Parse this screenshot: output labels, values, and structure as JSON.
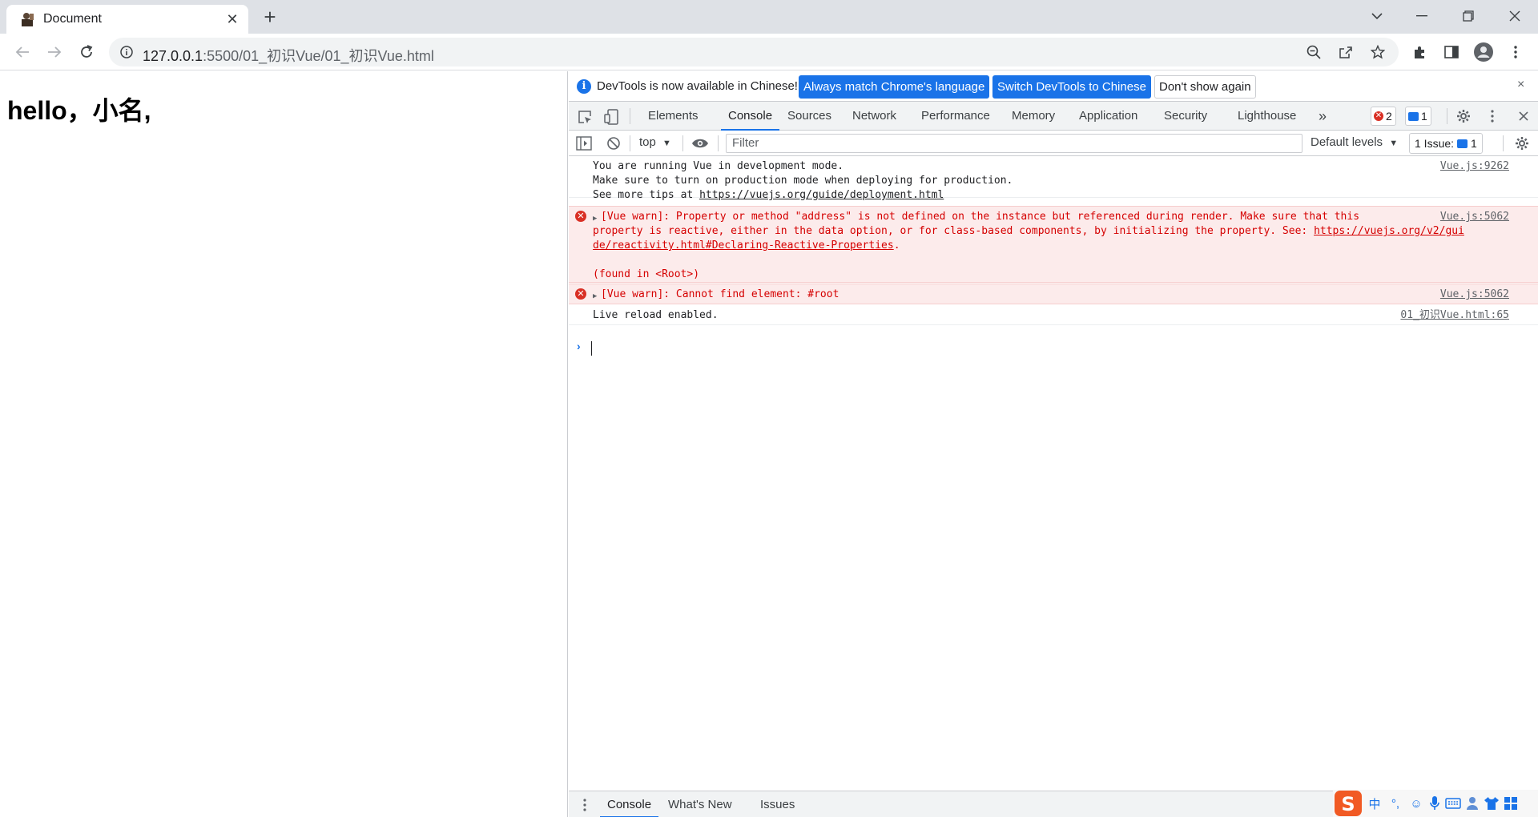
{
  "tab": {
    "title": "Document",
    "close_glyph": "✕",
    "new_tab_glyph": "+"
  },
  "window_controls": [
    "chevron-down-icon",
    "minimize-icon",
    "restore-icon",
    "close-icon"
  ],
  "address_bar": {
    "host": "127.0.0.1",
    "path": ":5500/01_初识Vue/01_初识Vue.html"
  },
  "page": {
    "heading": "hello，小名,"
  },
  "devtools": {
    "infobar": {
      "text": "DevTools is now available in Chinese!",
      "button_match": "Always match Chrome's language",
      "button_switch": "Switch DevTools to Chinese",
      "button_dismiss": "Don't show again",
      "close_glyph": "×"
    },
    "tabs": [
      "Elements",
      "Console",
      "Sources",
      "Network",
      "Performance",
      "Memory",
      "Application",
      "Security",
      "Lighthouse"
    ],
    "active_tab": "Console",
    "more_tabs_glyph": "»",
    "error_count": "2",
    "message_count": "1",
    "console_toolbar": {
      "context": "top",
      "filter_placeholder": "Filter",
      "levels": "Default levels",
      "issues_label": "1 Issue:",
      "issues_count": "1"
    },
    "messages": [
      {
        "type": "log",
        "lines": [
          "You are running Vue in development mode.",
          "Make sure to turn on production mode when deploying for production.",
          "See more tips at "
        ],
        "link": "https://vuejs.org/guide/deployment.html",
        "source": "Vue.js:9262"
      },
      {
        "type": "error",
        "line1": "[Vue warn]: Property or method \"address\" is not defined on the instance but referenced during render. Make sure that this",
        "line2_text": "property is reactive, either in the data option, or for class-based components, by initializing the property. See: ",
        "line2_link": "https://vuejs.org/v2/gui",
        "line3_link": "de/reactivity.html#Declaring-Reactive-Properties",
        "line3_tail": ".",
        "line5": "(found in <Root>)",
        "source": "Vue.js:5062"
      },
      {
        "type": "error",
        "line1": "[Vue warn]: Cannot find element: #root",
        "source": "Vue.js:5062"
      },
      {
        "type": "log",
        "line1": "Live reload enabled.",
        "source": "01_初识Vue.html:65"
      }
    ],
    "drawer_tabs": [
      "Console",
      "What's New",
      "Issues"
    ]
  },
  "ime_tray": {
    "lang": "中",
    "punct": "°,"
  },
  "colors": {
    "accent": "#1a73e8",
    "error": "#d50000",
    "error_bg": "#fcebeb"
  }
}
